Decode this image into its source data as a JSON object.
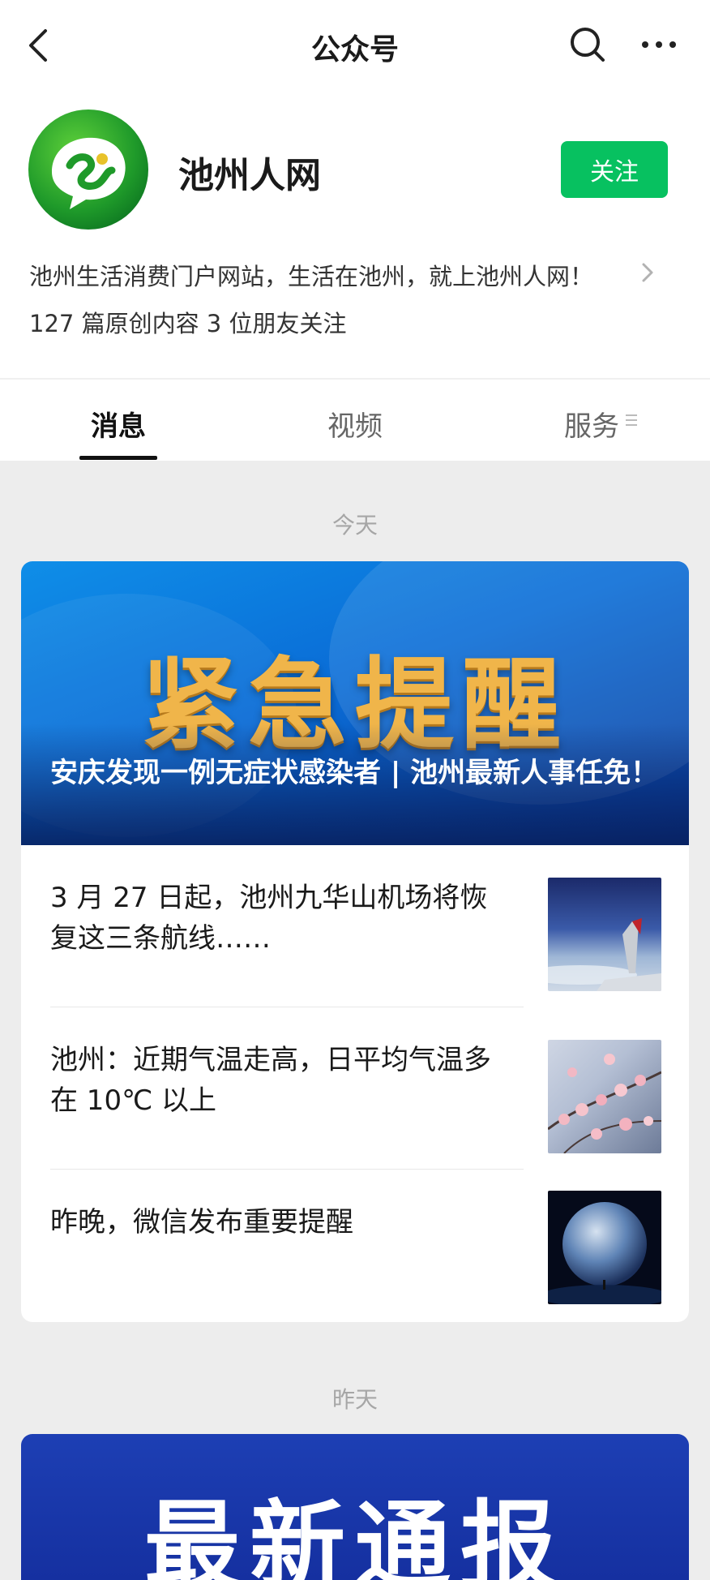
{
  "topbar": {
    "title": "公众号",
    "icons": [
      "back-icon",
      "search-icon",
      "more-icon"
    ]
  },
  "profile": {
    "name": "池州人网",
    "follow_label": "关注",
    "description": "池州生活消费门户网站，生活在池州，就上池州人网！",
    "stats": "127 篇原创内容  3 位朋友关注",
    "brand_color": "#07c160"
  },
  "tabs": [
    {
      "label": "消息"
    },
    {
      "label": "视频"
    },
    {
      "label": "服务"
    }
  ],
  "feed": {
    "today_label": "今天",
    "yesterday_label": "昨天",
    "today_card": {
      "banner_text": "紧急提醒",
      "headline": "安庆发现一例无症状感染者 | 池州最新人事任免！",
      "items": [
        {
          "title": "3 月 27 日起，池州九华山机场将恢复这三条航线……",
          "thumb": "airplane-wing-image"
        },
        {
          "title": "池州：近期气温走高，日平均气温多在 10℃ 以上",
          "thumb": "blossom-image"
        },
        {
          "title": "昨晚，微信发布重要提醒",
          "thumb": "earth-image"
        }
      ]
    },
    "yesterday_card": {
      "banner_text": "最新通报"
    }
  }
}
